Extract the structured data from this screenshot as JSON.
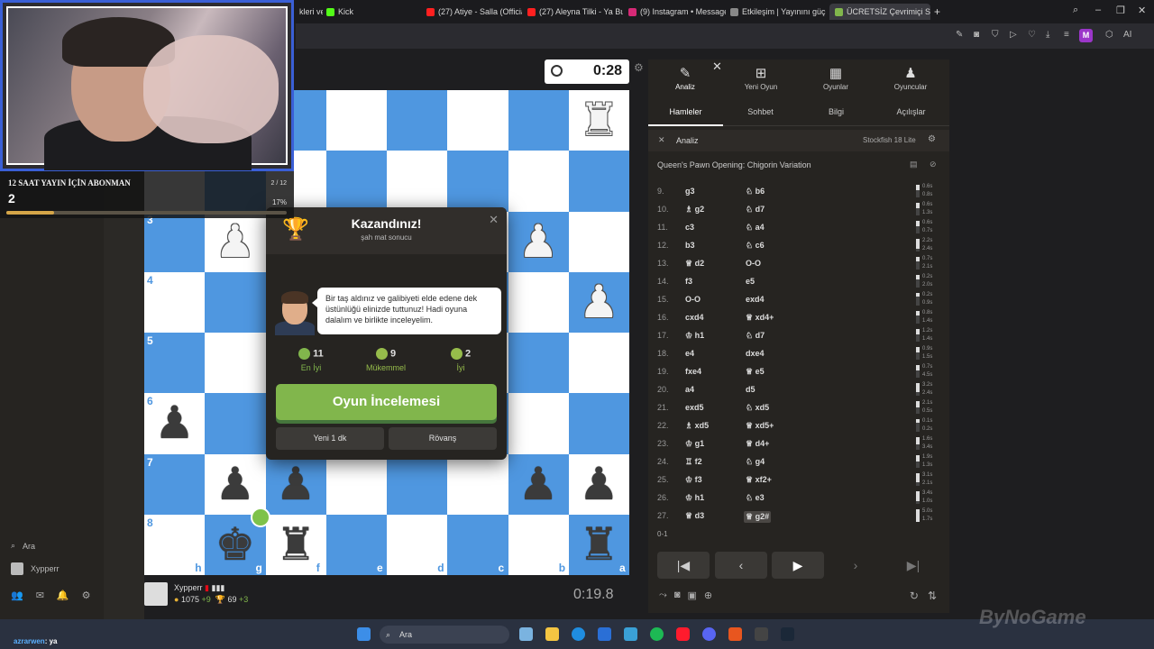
{
  "browser": {
    "tabs": [
      {
        "label": "kleri ve",
        "color": "#2b2b30"
      },
      {
        "label": "Kick",
        "color": "#53fc18"
      },
      {
        "label": "(27) Atiye - Salla (Official",
        "color": "#ff2020"
      },
      {
        "label": "(27) Aleyna Tilki - Ya Bu İş",
        "color": "#ff2020"
      },
      {
        "label": "(9) Instagram • Messages",
        "color": "#d62976"
      },
      {
        "label": "Etkileşim | Yayınını güç",
        "color": "#888888"
      },
      {
        "label": "ÜCRETSİZ Çevrimiçi Satranç",
        "color": "#81b64c"
      }
    ],
    "new_tab": "+",
    "profile_initial": "M",
    "ai_label": "AI"
  },
  "stream_overlay": {
    "goal_title": "12 SAAT YAYIN İÇİN ABONMAN",
    "goal_current": "2",
    "goal_fraction": "2 / 12",
    "goal_percent_label": "17%",
    "goal_progress": 0.17
  },
  "board": {
    "rank_labels": [
      "3",
      "4",
      "5",
      "6",
      "7",
      "8"
    ],
    "file_labels": [
      "h",
      "g",
      "f",
      "e",
      "d",
      "c",
      "b",
      "a"
    ],
    "light_color": "#ffffff",
    "dark_color": "#4f97e0"
  },
  "clocks": {
    "opponent_time": "0:28",
    "player_time": "0:19.8"
  },
  "player": {
    "name": "Xypperr",
    "rating": "1075",
    "rating_change": "+9",
    "trophies": "69",
    "trophy_change": "+3"
  },
  "sidebar": {
    "search_label": "Ara",
    "user_label": "Xypperr"
  },
  "modal": {
    "title": "Kazandınız!",
    "subtitle": "şah mat sonucu",
    "coach_message": "Bir taş aldınız ve galibiyeti elde edene dek üstünlüğü elinizde tuttunuz! Hadi oyuna dalalım ve birlikte inceleyelim.",
    "stats": [
      {
        "count": "11",
        "label": "En İyi",
        "color": "#81b64c"
      },
      {
        "count": "9",
        "label": "Mükemmel",
        "color": "#96bc4b"
      },
      {
        "count": "2",
        "label": "İyi",
        "color": "#96bc4b"
      }
    ],
    "review_button": "Oyun İncelemesi",
    "new_game_button": "Yeni 1 dk",
    "rematch_button": "Rövanş"
  },
  "right_panel": {
    "nav": [
      {
        "label": "Analiz",
        "icon": "✎"
      },
      {
        "label": "Yeni Oyun",
        "icon": "⊞"
      },
      {
        "label": "Oyunlar",
        "icon": "▦"
      },
      {
        "label": "Oyuncular",
        "icon": "♟"
      }
    ],
    "subtabs": [
      "Hamleler",
      "Sohbet",
      "Bilgi",
      "Açılışlar"
    ],
    "analysis_label": "Analiz",
    "engine_label": "Stockfish 18 Lite",
    "opening": "Queen's Pawn Opening: Chigorin Variation",
    "moves": [
      {
        "n": "9.",
        "w": "g3",
        "b": "♘ b6",
        "wf": 0.45,
        "e1": "0.6s",
        "e2": "0.8s"
      },
      {
        "n": "10.",
        "w": "♗ g2",
        "b": "♘ d7",
        "wf": 0.4,
        "e1": "0.6s",
        "e2": "1.3s"
      },
      {
        "n": "11.",
        "w": "c3",
        "b": "♘ a4",
        "wf": 0.4,
        "e1": "0.6s",
        "e2": "0.7s"
      },
      {
        "n": "12.",
        "w": "b3",
        "b": "♘ c6",
        "wf": 0.75,
        "e1": "2.2s",
        "e2": "2.4s"
      },
      {
        "n": "13.",
        "w": "♕ d2",
        "b": "O-O",
        "wf": 0.35,
        "e1": "0.7s",
        "e2": "2.1s"
      },
      {
        "n": "14.",
        "w": "f3",
        "b": "e5",
        "wf": 0.35,
        "e1": "0.2s",
        "e2": "2.0s"
      },
      {
        "n": "15.",
        "w": "O-O",
        "b": "exd4",
        "wf": 0.3,
        "e1": "0.2s",
        "e2": "0.9s"
      },
      {
        "n": "16.",
        "w": "cxd4",
        "b": "♕ xd4+",
        "wf": 0.35,
        "e1": "0.8s",
        "e2": "1.4s"
      },
      {
        "n": "17.",
        "w": "♔ h1",
        "b": "♘ d7",
        "wf": 0.45,
        "e1": "1.2s",
        "e2": "1.4s"
      },
      {
        "n": "18.",
        "w": "e4",
        "b": "dxe4",
        "wf": 0.4,
        "e1": "0.9s",
        "e2": "1.5s"
      },
      {
        "n": "19.",
        "w": "fxe4",
        "b": "♕ e5",
        "wf": 0.4,
        "e1": "0.7s",
        "e2": "4.5s"
      },
      {
        "n": "20.",
        "w": "a4",
        "b": "d5",
        "wf": 0.7,
        "e1": "3.2s",
        "e2": "2.4s"
      },
      {
        "n": "21.",
        "w": "exd5",
        "b": "♘ xd5",
        "wf": 0.5,
        "e1": "2.1s",
        "e2": "0.5s"
      },
      {
        "n": "22.",
        "w": "♗ xd5",
        "b": "♕ xd5+",
        "wf": 0.3,
        "e1": "0.1s",
        "e2": "0.2s"
      },
      {
        "n": "23.",
        "w": "♔ g1",
        "b": "♕ d4+",
        "wf": 0.55,
        "e1": "1.6s",
        "e2": "3.4s"
      },
      {
        "n": "24.",
        "w": "♖ f2",
        "b": "♘ g4",
        "wf": 0.5,
        "e1": "1.9s",
        "e2": "1.3s"
      },
      {
        "n": "25.",
        "w": "♔ f3",
        "b": "♕ xf2+",
        "wf": 0.7,
        "e1": "3.1s",
        "e2": "2.1s"
      },
      {
        "n": "26.",
        "w": "♔ h1",
        "b": "♘ e3",
        "wf": 0.75,
        "e1": "3.4s",
        "e2": "1.0s"
      },
      {
        "n": "27.",
        "w": "♕ d3",
        "b": "♕ g2#",
        "wf": 1.0,
        "e1": "5.0s",
        "e2": "1.7s"
      }
    ],
    "result": "0-1"
  },
  "taskbar": {
    "search_label": "Ara"
  },
  "chat": {
    "user": "azrarwen",
    "message": ": ya"
  },
  "watermark": "ByNoGame"
}
